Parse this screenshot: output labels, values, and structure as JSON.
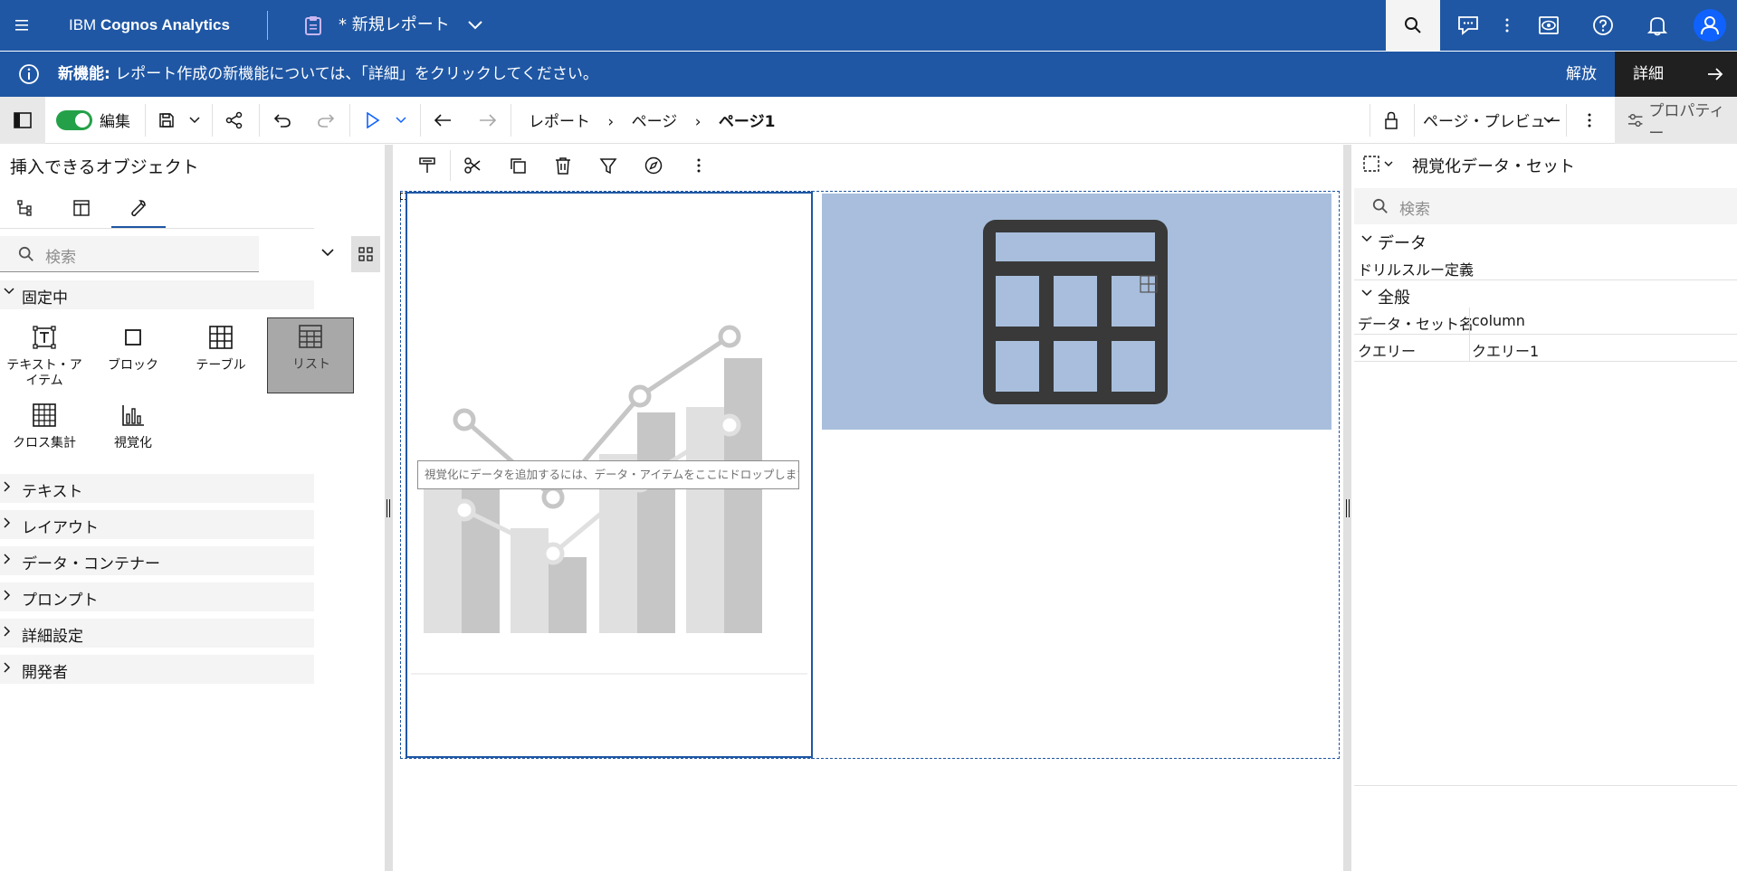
{
  "app": {
    "brand_prefix": "IBM ",
    "brand_name": "Cognos Analytics",
    "report_title": "* 新規レポート"
  },
  "banner": {
    "bold": "新機能:",
    "message": " レポート作成の新機能については、「詳細」をクリックしてください。",
    "dismiss": "解放",
    "details": "詳細"
  },
  "toolbar": {
    "edit_label": "編集",
    "breadcrumb": [
      "レポート",
      "ページ",
      "ページ1"
    ],
    "preview_label": "ページ・プレビュー",
    "properties_label": "プロパティー"
  },
  "left_panel": {
    "title": "挿入できるオブジェクト",
    "search_placeholder": "検索",
    "pinned_section": "固定中",
    "tiles": [
      {
        "label": "テキスト・アイテム",
        "icon": "text-item-icon"
      },
      {
        "label": "ブロック",
        "icon": "block-icon"
      },
      {
        "label": "テーブル",
        "icon": "table-icon"
      },
      {
        "label": "リスト",
        "icon": "list-icon"
      },
      {
        "label": "クロス集計",
        "icon": "crosstab-icon"
      },
      {
        "label": "視覚化",
        "icon": "visualization-icon"
      }
    ],
    "sections": [
      "テキスト",
      "レイアウト",
      "データ・コンテナー",
      "プロンプト",
      "詳細設定",
      "開発者"
    ]
  },
  "canvas": {
    "drop_hint": "視覚化にデータを追加するには、データ・アイテムをここにドロップします。"
  },
  "right_panel": {
    "title": "視覚化データ・セット",
    "search_placeholder": "検索",
    "groups": [
      {
        "label": "データ",
        "rows": [
          {
            "key": "ドリルスルー定義",
            "value": ""
          }
        ]
      },
      {
        "label": "全般",
        "rows": [
          {
            "key": "データ・セット名",
            "value": "column"
          },
          {
            "key": "クエリー",
            "value": "クエリー1"
          }
        ]
      }
    ]
  },
  "colors": {
    "brand_blue": "#1f57a4",
    "toggle_green": "#24a148",
    "table_area": "#a8bedc"
  }
}
